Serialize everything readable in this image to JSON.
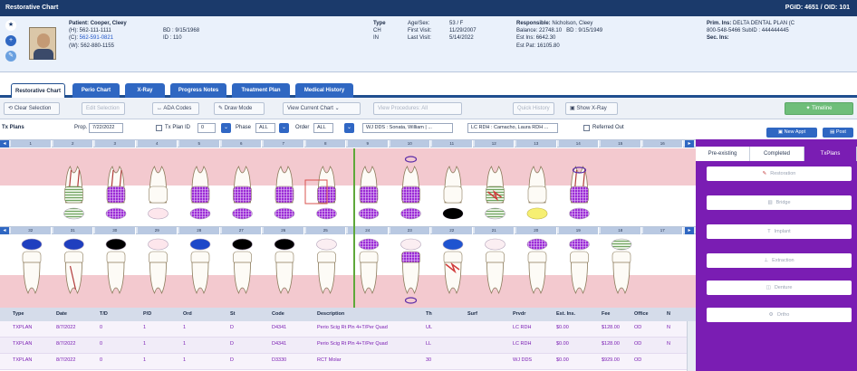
{
  "window": {
    "title": "Restorative Chart",
    "right_info": "PGID: 4651 / OID: 101"
  },
  "patient": {
    "name_label": "Patient:",
    "name": "Cooper, Cleey",
    "home_label": "(H):",
    "home_phone": "562-111-1111",
    "cell_label": "(C):",
    "cell_phone": "562-591-0821",
    "work_label": "(W):",
    "work_phone": "562-880-1155",
    "bd_label": "BD :",
    "bd": "9/15/1968",
    "id_label": "ID :",
    "id": "110",
    "type_header": "Type",
    "type_ch": "CH",
    "type_in": "IN",
    "agesex_label": "Age/Sex:",
    "agesex": "53 / F",
    "first_visit_label": "First Visit:",
    "first_visit": "11/29/2007",
    "last_visit_label": "Last Visit:",
    "last_visit": "5/14/2022",
    "responsible_label": "Responsible:",
    "responsible": "Nicholson, Cleey",
    "balance_label": "Balance:",
    "balance": "22748.10",
    "resp_bd_label": "BD :",
    "resp_bd": "9/15/1949",
    "est_ins_label": "Est Ins:",
    "est_ins": "6642.30",
    "est_pat_label": "Est Pat:",
    "est_pat": "16105.80",
    "prim_ins_label": "Prim. Ins:",
    "prim_ins": "DELTA DENTAL PLAN (C",
    "prim_ins_phone": "800-548-5466 SubID : 444444445",
    "sec_ins_label": "Sec. Ins:"
  },
  "tabs": [
    "Restorative Chart",
    "Perio Chart",
    "X-Ray",
    "Progress Notes",
    "Treatment Plan",
    "Medical History"
  ],
  "toolbar": {
    "clear_selection": "Clear Selection",
    "edit_selection": "Edit Selection",
    "ada_codes": "ADA Codes",
    "draw_mode": "Draw Mode",
    "view_chart": "View Current Chart",
    "view_procedures": "View Procedures: All",
    "quick_history": "Quick History",
    "show_xray": "Show X-Ray",
    "timeline": "Timeline"
  },
  "filters": {
    "tx_plans_label": "Tx Plans",
    "prop_dt_label": "Prop. Dt",
    "prop_dt": "7/22/2022",
    "tx_plan_id_label": "Tx Plan ID",
    "tx_plan_id": "0",
    "phase_label": "Phase",
    "phase": "ALL",
    "order_label": "Order",
    "order": "ALL",
    "provider1": "WJ DDS : Sonata, William | ...",
    "provider2": "LC RDH : Camacho, Laura RDH ...",
    "referred_out_label": "Referred Out",
    "new_appt": "New Appt",
    "post": "Post"
  },
  "tooth_numbers_upper": [
    "1",
    "2",
    "3",
    "4",
    "5",
    "6",
    "7",
    "8",
    "9",
    "10",
    "11",
    "12",
    "13",
    "14",
    "15",
    "16"
  ],
  "tooth_numbers_lower": [
    "32",
    "31",
    "30",
    "29",
    "28",
    "27",
    "26",
    "25",
    "24",
    "23",
    "22",
    "21",
    "20",
    "19",
    "18",
    "17"
  ],
  "right_panel": {
    "tabs": [
      "Pre-existing",
      "Completed",
      "TxPlans"
    ],
    "buttons": [
      "Restoration",
      "Bridge",
      "Implant",
      "Extraction",
      "Denture",
      "Ortho"
    ]
  },
  "table": {
    "headers": [
      "Type",
      "Date",
      "T/D",
      "P/D",
      "Ord",
      "St",
      "Code",
      "Description",
      "Th",
      "Surf",
      "Prvdr",
      "Est. Ins.",
      "Fee",
      "Office",
      "N"
    ],
    "rows": [
      [
        "TXPLAN",
        "8/7/2022",
        "0",
        "1",
        "1",
        "D",
        "D4341",
        "Perio Scig Rt Pln 4+T/Per Quad",
        "UL",
        "",
        "LC RDH",
        "$0.00",
        "$128.00",
        "OD",
        "N"
      ],
      [
        "TXPLAN",
        "8/7/2022",
        "0",
        "1",
        "1",
        "D",
        "D4341",
        "Perio Scig Rt Pln 4+T/Per Quad",
        "LL",
        "",
        "LC RDH",
        "$0.00",
        "$128.00",
        "OD",
        "N"
      ],
      [
        "TXPLAN",
        "8/7/2022",
        "0",
        "1",
        "1",
        "D",
        "D3330",
        "RCT Molar",
        "30",
        "",
        "WJ DDS",
        "$0.00",
        "$929.00",
        "OD",
        ""
      ]
    ]
  },
  "colors": {
    "txplan_purple": "#7a1db3",
    "header_blue": "#1b3a6b",
    "tab_blue": "#2f67c2",
    "band_pink": "#f3c9cf",
    "green_line": "#5ea83a"
  }
}
